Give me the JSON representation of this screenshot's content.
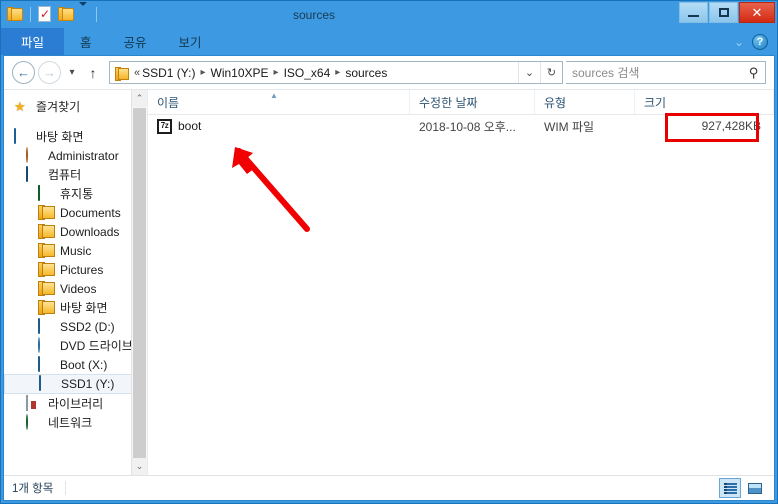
{
  "window": {
    "title": "sources",
    "quick_access": [
      {
        "name": "folder-icon",
        "label": "폴더"
      },
      {
        "name": "properties-icon",
        "label": "속성"
      },
      {
        "name": "new-folder-icon",
        "label": "새 폴더"
      },
      {
        "name": "customize-caret-icon",
        "label": "빠른 실행 도구 모음 사용자 지정"
      }
    ],
    "controls": {
      "minimize": "최소화",
      "maximize": "최대화",
      "close": "✕"
    }
  },
  "ribbon": {
    "tabs": [
      {
        "label": "파일",
        "active": true
      },
      {
        "label": "홈",
        "active": false
      },
      {
        "label": "공유",
        "active": false
      },
      {
        "label": "보기",
        "active": false
      }
    ],
    "collapse_label": "⌄",
    "help_label": "?"
  },
  "address": {
    "back_label": "←",
    "forward_label": "→",
    "recent_label": "▾",
    "up_label": "↑",
    "prefix": "«",
    "crumbs": [
      "SSD1 (Y:)",
      "Win10XPE",
      "ISO_x64",
      "sources"
    ],
    "separator": "▸",
    "dropdown_label": "⌄",
    "refresh_label": "↻"
  },
  "search": {
    "placeholder": "sources 검색",
    "value": "",
    "icon": "search-icon"
  },
  "sidebar": {
    "items": [
      {
        "label": "즐겨찾기",
        "icon": "star-icon",
        "indent": 0,
        "selected": false,
        "gap_after": true
      },
      {
        "label": "바탕 화면",
        "icon": "desktop-icon",
        "indent": 0,
        "selected": false
      },
      {
        "label": "Administrator",
        "icon": "user-icon",
        "indent": 1,
        "selected": false
      },
      {
        "label": "컴퓨터",
        "icon": "computer-icon",
        "indent": 1,
        "selected": false
      },
      {
        "label": "휴지통",
        "icon": "recycle-bin-icon",
        "indent": 2,
        "selected": false
      },
      {
        "label": "Documents",
        "icon": "folder-icon",
        "indent": 2,
        "selected": false
      },
      {
        "label": "Downloads",
        "icon": "folder-icon",
        "indent": 2,
        "selected": false
      },
      {
        "label": "Music",
        "icon": "folder-icon",
        "indent": 2,
        "selected": false
      },
      {
        "label": "Pictures",
        "icon": "folder-icon",
        "indent": 2,
        "selected": false
      },
      {
        "label": "Videos",
        "icon": "folder-icon",
        "indent": 2,
        "selected": false
      },
      {
        "label": "바탕 화면",
        "icon": "folder-icon",
        "indent": 2,
        "selected": false
      },
      {
        "label": "SSD2 (D:)",
        "icon": "drive-icon",
        "indent": 2,
        "selected": false
      },
      {
        "label": "DVD 드라이브",
        "icon": "dvd-icon",
        "indent": 2,
        "selected": false
      },
      {
        "label": "Boot (X:)",
        "icon": "drive-icon",
        "indent": 2,
        "selected": false
      },
      {
        "label": "SSD1 (Y:)",
        "icon": "drive-icon",
        "indent": 2,
        "selected": true
      },
      {
        "label": "라이브러리",
        "icon": "library-icon",
        "indent": 1,
        "selected": false
      },
      {
        "label": "네트워크",
        "icon": "network-icon",
        "indent": 1,
        "selected": false
      }
    ],
    "scroll_up_label": "⌃",
    "scroll_down_label": "⌄"
  },
  "filelist": {
    "columns": [
      {
        "key": "name",
        "label": "이름",
        "sorted": true,
        "sort_dir": "asc"
      },
      {
        "key": "date",
        "label": "수정한 날짜",
        "sorted": false
      },
      {
        "key": "type",
        "label": "유형",
        "sorted": false
      },
      {
        "key": "size",
        "label": "크기",
        "sorted": false
      }
    ],
    "sort_indicator": "▲",
    "rows": [
      {
        "name": "boot",
        "icon": "sevenzip-file-icon",
        "icon_text": "7z",
        "date": "2018-10-08 오후...",
        "type": "WIM 파일",
        "size": "927,428KB"
      }
    ]
  },
  "statusbar": {
    "item_count": "1개 항목",
    "views": [
      {
        "name": "details-view",
        "label": "자세히",
        "active": true
      },
      {
        "name": "large-icons-view",
        "label": "큰 아이콘",
        "active": false
      }
    ]
  },
  "annotations": {
    "size_highlight": {
      "color": "#e80000",
      "target": "927,428KB"
    },
    "arrow": {
      "color": "#f00000",
      "outline": "#ffffff",
      "points_to": "boot"
    }
  },
  "colors": {
    "titlebar": "#3d9ae2",
    "file_tab": "#2b7cd3",
    "close_button": "#d42a12",
    "selection": "#f2f6fa",
    "annotation_red": "#e80000"
  }
}
